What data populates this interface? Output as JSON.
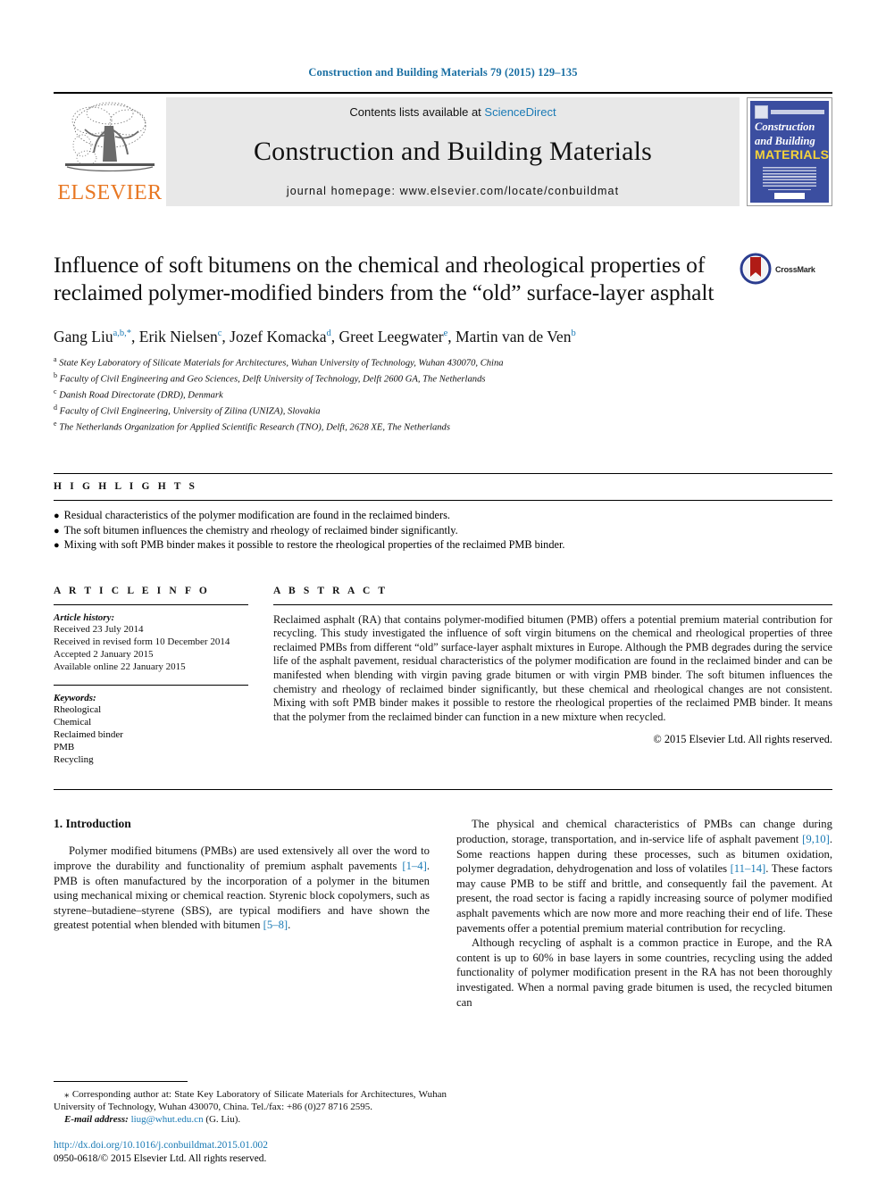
{
  "running_head": "Construction and Building Materials 79 (2015) 129–135",
  "masthead": {
    "publisher_name": "ELSEVIER",
    "contents_prefix": "Contents lists available at ",
    "contents_link": "ScienceDirect",
    "journal_name": "Construction and Building Materials",
    "homepage": "journal homepage: www.elsevier.com/locate/conbuildmat",
    "cover": {
      "line1": "Construction",
      "line2": "and Building",
      "line3": "MATERIALS"
    }
  },
  "article": {
    "title": "Influence of soft bitumens on the chemical and rheological properties of reclaimed polymer-modified binders from the “old” surface-layer asphalt",
    "crossmark_label": "CrossMark",
    "authors": [
      {
        "name": "Gang Liu",
        "marks": "a,b,*"
      },
      {
        "name": "Erik Nielsen",
        "marks": "c"
      },
      {
        "name": "Jozef Komacka",
        "marks": "d"
      },
      {
        "name": "Greet Leegwater",
        "marks": "e"
      },
      {
        "name": "Martin van de Ven",
        "marks": "b"
      }
    ],
    "affiliations": [
      {
        "mark": "a",
        "text": "State Key Laboratory of Silicate Materials for Architectures, Wuhan University of Technology, Wuhan 430070, China"
      },
      {
        "mark": "b",
        "text": "Faculty of Civil Engineering and Geo Sciences, Delft University of Technology, Delft 2600 GA, The Netherlands"
      },
      {
        "mark": "c",
        "text": "Danish Road Directorate (DRD), Denmark"
      },
      {
        "mark": "d",
        "text": "Faculty of Civil Engineering, University of Zilina (UNIZA), Slovakia"
      },
      {
        "mark": "e",
        "text": "The Netherlands Organization for Applied Scientific Research (TNO), Delft, 2628 XE, The Netherlands"
      }
    ]
  },
  "highlights": {
    "heading": "H I G H L I G H T S",
    "items": [
      "Residual characteristics of the polymer modification are found in the reclaimed binders.",
      "The soft bitumen influences the chemistry and rheology of reclaimed binder significantly.",
      "Mixing with soft PMB binder makes it possible to restore the rheological properties of the reclaimed PMB binder."
    ]
  },
  "article_info": {
    "heading": "A R T I C L E    I N F O",
    "history_label": "Article history:",
    "history": [
      "Received 23 July 2014",
      "Received in revised form 10 December 2014",
      "Accepted 2 January 2015",
      "Available online 22 January 2015"
    ],
    "keywords_label": "Keywords:",
    "keywords": [
      "Rheological",
      "Chemical",
      "Reclaimed binder",
      "PMB",
      "Recycling"
    ]
  },
  "abstract": {
    "heading": "A B S T R A C T",
    "text": "Reclaimed asphalt (RA) that contains polymer-modified bitumen (PMB) offers a potential premium material contribution for recycling. This study investigated the influence of soft virgin bitumens on the chemical and rheological properties of three reclaimed PMBs from different “old” surface-layer asphalt mixtures in Europe. Although the PMB degrades during the service life of the asphalt pavement, residual characteristics of the polymer modification are found in the reclaimed binder and can be manifested when blending with virgin paving grade bitumen or with virgin PMB binder. The soft bitumen influences the chemistry and rheology of reclaimed binder significantly, but these chemical and rheological changes are not consistent. Mixing with soft PMB binder makes it possible to restore the rheological properties of the reclaimed PMB binder. It means that the polymer from the reclaimed binder can function in a new mixture when recycled.",
    "copyright": "© 2015 Elsevier Ltd. All rights reserved."
  },
  "body": {
    "section_title": "1. Introduction",
    "left_paragraphs": [
      {
        "segments": [
          {
            "t": "Polymer modified bitumens (PMBs) are used extensively all over the word to improve the durability and functionality of premium asphalt pavements "
          },
          {
            "t": "[1–4]",
            "ref": true
          },
          {
            "t": ". PMB is often manufactured by the incorporation of a polymer in the bitumen using mechanical mixing or chemical reaction. Styrenic block copolymers, such as styrene–butadiene–styrene (SBS), are typical modifiers and have shown the greatest potential when blended with bitumen "
          },
          {
            "t": "[5–8]",
            "ref": true
          },
          {
            "t": "."
          }
        ]
      }
    ],
    "right_paragraphs": [
      {
        "segments": [
          {
            "t": "The physical and chemical characteristics of PMBs can change during production, storage, transportation, and in-service life of asphalt pavement "
          },
          {
            "t": "[9,10]",
            "ref": true
          },
          {
            "t": ". Some reactions happen during these processes, such as bitumen oxidation, polymer degradation, dehydrogenation and loss of volatiles "
          },
          {
            "t": "[11–14]",
            "ref": true
          },
          {
            "t": ". These factors may cause PMB to be stiff and brittle, and consequently fail the pavement. At present, the road sector is facing a rapidly increasing source of polymer modified asphalt pavements which are now more and more reaching their end of life. These pavements offer a potential premium material contribution for recycling."
          }
        ]
      },
      {
        "segments": [
          {
            "t": "Although recycling of asphalt is a common practice in Europe, and the RA content is up to 60% in base layers in some countries, recycling using the added functionality of polymer modification present in the RA has not been thoroughly investigated. When a normal paving grade bitumen is used, the recycled bitumen can"
          }
        ]
      }
    ]
  },
  "footnote": {
    "corresponding": "⁎ Corresponding author at: State Key Laboratory of Silicate Materials for Architectures, Wuhan University of Technology, Wuhan 430070, China. Tel./fax: +86 (0)27 8716 2595.",
    "email_label": "E-mail address:",
    "email": "liug@whut.edu.cn",
    "email_suffix": " (G. Liu)."
  },
  "imprint": {
    "doi": "http://dx.doi.org/10.1016/j.conbuildmat.2015.01.002",
    "issn_line": "0950-0618/© 2015 Elsevier Ltd. All rights reserved."
  },
  "colors": {
    "link_blue": "#1a7ab5",
    "elsevier_orange": "#e87722",
    "cover_blue": "#3b4ea0"
  }
}
